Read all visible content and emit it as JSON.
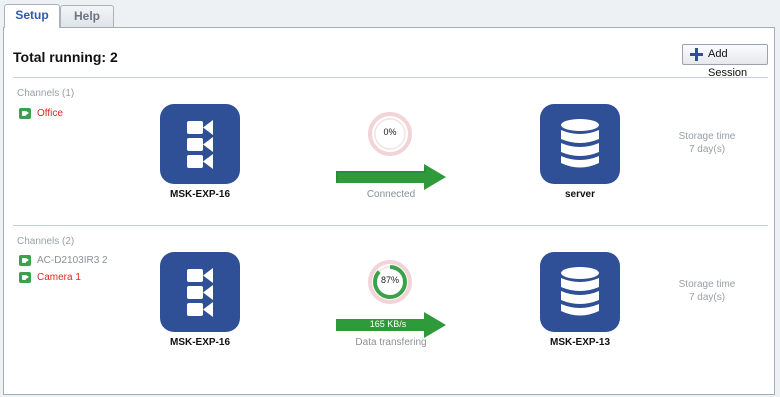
{
  "tabs": [
    {
      "label": "Setup",
      "active": true
    },
    {
      "label": "Help",
      "active": false
    }
  ],
  "header": {
    "total_running": "Total running: 2",
    "add_session_label": "Add Session"
  },
  "sessions": [
    {
      "channels_header": "Channels (1)",
      "channels": [
        {
          "name": "Office",
          "color": "#e0261e"
        }
      ],
      "source": {
        "name": "MSK-EXP-16",
        "icon": "camera-group-icon"
      },
      "progress_percent": 0,
      "progress_label": "0%",
      "rate_label": "",
      "status": "Connected",
      "destination": {
        "name": "server",
        "icon": "database-icon"
      },
      "storage_label": "Storage time",
      "storage_value": "7 day(s)"
    },
    {
      "channels_header": "Channels (2)",
      "channels": [
        {
          "name": "AC-D2103IR3 2",
          "color": "#8b9096"
        },
        {
          "name": "Camera 1",
          "color": "#e0261e"
        }
      ],
      "source": {
        "name": "MSK-EXP-16",
        "icon": "camera-group-icon"
      },
      "progress_percent": 87,
      "progress_label": "87%",
      "rate_label": "165 KB/s",
      "status": "Data transfering",
      "destination": {
        "name": "MSK-EXP-13",
        "icon": "database-icon"
      },
      "storage_label": "Storage time",
      "storage_value": "7 day(s)"
    }
  ],
  "colors": {
    "tile": "#2f4f96",
    "arrow": "#2f9a3a",
    "channel_icon": "#3aa24a",
    "active_channel": "#e0261e",
    "progress_track": "#f2c9cc",
    "progress_fill": "#3aa24a"
  }
}
